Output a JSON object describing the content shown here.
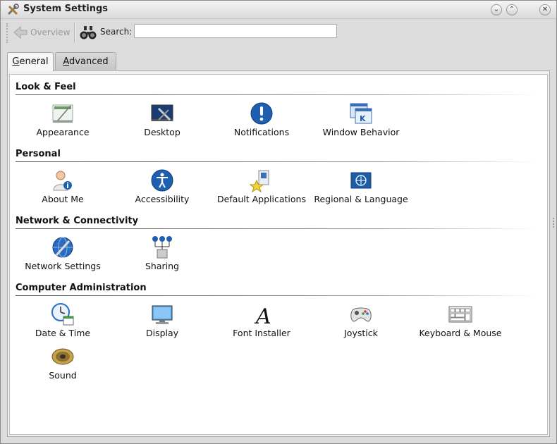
{
  "window": {
    "title": "System Settings"
  },
  "toolbar": {
    "overview_label": "Overview",
    "search_label": "Search:",
    "search_value": "",
    "search_placeholder": ""
  },
  "tabs": [
    {
      "label_first": "G",
      "label_rest": "eneral"
    },
    {
      "label_first": "A",
      "label_rest": "dvanced"
    }
  ],
  "sections": [
    {
      "title": "Look & Feel",
      "items": [
        "Appearance",
        "Desktop",
        "Notifications",
        "Window Behavior"
      ]
    },
    {
      "title": "Personal",
      "items": [
        "About Me",
        "Accessibility",
        "Default Applications",
        "Regional & Language"
      ]
    },
    {
      "title": "Network & Connectivity",
      "items": [
        "Network Settings",
        "Sharing"
      ]
    },
    {
      "title": "Computer Administration",
      "items": [
        "Date & Time",
        "Display",
        "Font Installer",
        "Joystick",
        "Keyboard & Mouse",
        "Sound"
      ]
    }
  ],
  "colors": {
    "accent_blue": "#1f5fb0",
    "section_rule": "#555555"
  }
}
